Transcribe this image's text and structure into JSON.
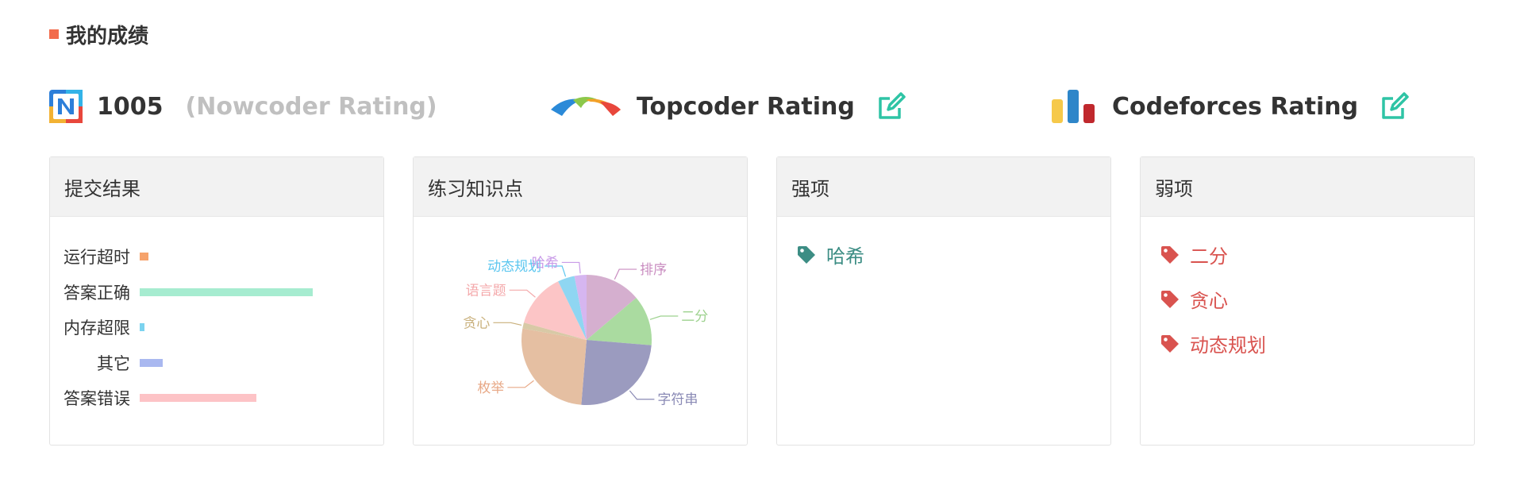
{
  "section": {
    "title": "我的成绩"
  },
  "ratings": {
    "nowcoder": {
      "value": "1005",
      "label": "(Nowcoder Rating)"
    },
    "topcoder": {
      "label": "Topcoder Rating"
    },
    "codeforces": {
      "label": "Codeforces Rating"
    }
  },
  "cards": {
    "submissions": {
      "title": "提交结果"
    },
    "knowledge": {
      "title": "练习知识点"
    },
    "strengths": {
      "title": "强项",
      "tags": [
        "哈希"
      ]
    },
    "weaknesses": {
      "title": "弱项",
      "tags": [
        "二分",
        "贪心",
        "动态规划"
      ]
    }
  },
  "colors": {
    "accent": "#f26b4b",
    "edit": "#2ec4a5",
    "strong_tag": "#3c8d84",
    "weak_tag": "#d9534f"
  },
  "chart_data": [
    {
      "type": "bar",
      "orientation": "horizontal",
      "categories": [
        "运行超时",
        "答案正确",
        "内存超限",
        "其它",
        "答案错误"
      ],
      "values": [
        1,
        19,
        0.5,
        2.5,
        12.8
      ],
      "colors": [
        "#f6a36c",
        "#a6ecd0",
        "#7cd3ef",
        "#a9b8f0",
        "#fdc3c6"
      ],
      "axes_visible": false
    },
    {
      "type": "pie",
      "labels": [
        "排序",
        "二分",
        "字符串",
        "枚举",
        "贪心",
        "语言题",
        "动态规划",
        "哈希"
      ],
      "values": [
        13.8,
        12.5,
        25,
        26.5,
        1.5,
        13.5,
        4.2,
        3
      ],
      "colors": [
        "#d5afcf",
        "#aadba0",
        "#9b9bbf",
        "#e5bfa2",
        "#d8c9a6",
        "#fcc5c6",
        "#8fd6f2",
        "#d6b6f0"
      ],
      "label_colors": [
        "#c98cc0",
        "#9ed28f",
        "#8a8ab5",
        "#e8a987",
        "#c9b07c",
        "#f4a9ab",
        "#5bc6ef",
        "#c99be8"
      ]
    }
  ]
}
